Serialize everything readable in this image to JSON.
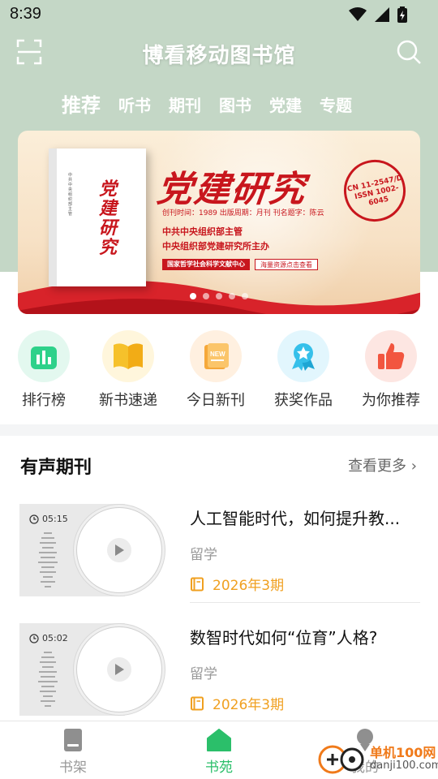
{
  "status_bar": {
    "time": "8:39"
  },
  "header": {
    "title": "博看移动图书馆"
  },
  "tabs": [
    {
      "label": "推荐",
      "active": true
    },
    {
      "label": "听书",
      "active": false
    },
    {
      "label": "期刊",
      "active": false
    },
    {
      "label": "图书",
      "active": false
    },
    {
      "label": "党建",
      "active": false
    },
    {
      "label": "专题",
      "active": false
    }
  ],
  "banner": {
    "book_title": "党建研究",
    "headline": "党建研究",
    "stamp_line1": "CN 11-2547/D",
    "stamp_line2": "ISSN 1002-6045",
    "meta": "创刊时间：1989  出版周期：月刊  刊名题字：陈云",
    "org1": "中共中央组织部主管",
    "org2": "中央组织部党建研究所主办",
    "pill_left": "国家哲学社会科学文献中心",
    "pill_right": "海量资源点击查看",
    "active_slide": 1,
    "slide_count": 5
  },
  "categories": [
    {
      "label": "排行榜",
      "icon": "ranking-icon",
      "color": "#2ed18a"
    },
    {
      "label": "新书速递",
      "icon": "open-book-icon",
      "color": "#f6c12b"
    },
    {
      "label": "今日新刊",
      "icon": "new-magazine-icon",
      "color": "#f5a83a"
    },
    {
      "label": "获奖作品",
      "icon": "award-icon",
      "color": "#36c0ea"
    },
    {
      "label": "为你推荐",
      "icon": "thumbs-up-icon",
      "color": "#f2553f"
    }
  ],
  "section": {
    "title": "有声期刊",
    "more": "查看更多"
  },
  "items": [
    {
      "title": "人工智能时代，如何提升教...",
      "category": "留学",
      "issue": "2026年3期",
      "duration": "05:15"
    },
    {
      "title": "数智时代如何“位育”人格?",
      "category": "留学",
      "issue": "2026年3期",
      "duration": "05:02"
    }
  ],
  "bottom_nav": [
    {
      "label": "书架",
      "icon": "bookshelf-icon",
      "active": false
    },
    {
      "label": "书苑",
      "icon": "home-icon",
      "active": true
    },
    {
      "label": "我的",
      "icon": "profile-icon",
      "active": false
    }
  ],
  "watermark": {
    "line1": "单机100网",
    "line2": "danji100.com"
  },
  "colors": {
    "accent": "#2bbf6a",
    "header_bg": "#c4d7c6",
    "issue": "#f0a020",
    "banner_red": "#c8161d"
  }
}
